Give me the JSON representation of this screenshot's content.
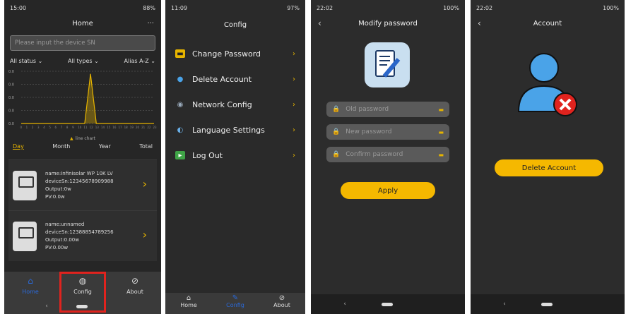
{
  "screen1": {
    "status_time": "15:00",
    "status_right": "88%",
    "title": "Home",
    "more": "···",
    "search_placeholder": "Please input the device SN",
    "filters": [
      "All status",
      "All types",
      "Alias A-Z"
    ],
    "chart_data": {
      "type": "line",
      "x": [
        0,
        1,
        2,
        3,
        4,
        5,
        6,
        7,
        8,
        9,
        10,
        11,
        12,
        13,
        14,
        15,
        16,
        17,
        18,
        19,
        20,
        21,
        22,
        23
      ],
      "y": [
        0,
        0,
        0,
        0,
        0,
        0,
        0,
        0,
        0,
        0,
        0,
        0,
        1,
        0,
        0,
        0,
        0,
        0,
        0,
        0,
        0,
        0,
        0,
        0
      ],
      "y_ticks": [
        "0.0",
        "0.0",
        "0.0",
        "0.0",
        "0.0"
      ],
      "x_tick_labels": [
        "0",
        "1",
        "2",
        "3",
        "4",
        "5",
        "6",
        "7",
        "8",
        "9",
        "10",
        "11",
        "12",
        "13",
        "14",
        "15",
        "16",
        "17",
        "18",
        "19",
        "20",
        "21",
        "22",
        "23"
      ],
      "legend": "line chart",
      "color": "#e6b400"
    },
    "periods": [
      "Day",
      "Month",
      "Year",
      "Total"
    ],
    "devices": [
      {
        "name": "name:Infinisolar WP 10K LV",
        "sn": "deviceSn:12345678909988",
        "output": "Output:0w",
        "pv": "PV:0.0w"
      },
      {
        "name": "name:unnamed",
        "sn": "deviceSn:12388854789256",
        "output": "Output:0.00w",
        "pv": "PV:0.00w"
      }
    ],
    "nav": [
      "Home",
      "Config",
      "About"
    ],
    "back": "‹"
  },
  "screen2": {
    "status_time": "11:09",
    "status_right": "97%",
    "title": "Config",
    "menu": [
      "Change Password",
      "Delete Account",
      "Network Config",
      "Language Settings",
      "Log Out"
    ],
    "nav": [
      "Home",
      "Config",
      "About"
    ]
  },
  "screen3": {
    "status_time": "22:02",
    "status_right": "100%",
    "title": "Modify password",
    "fields": [
      "Old password",
      "New password",
      "Confirm password"
    ],
    "apply": "Apply"
  },
  "screen4": {
    "status_time": "22:02",
    "status_right": "100%",
    "title": "Account",
    "delete": "Delete Account"
  }
}
